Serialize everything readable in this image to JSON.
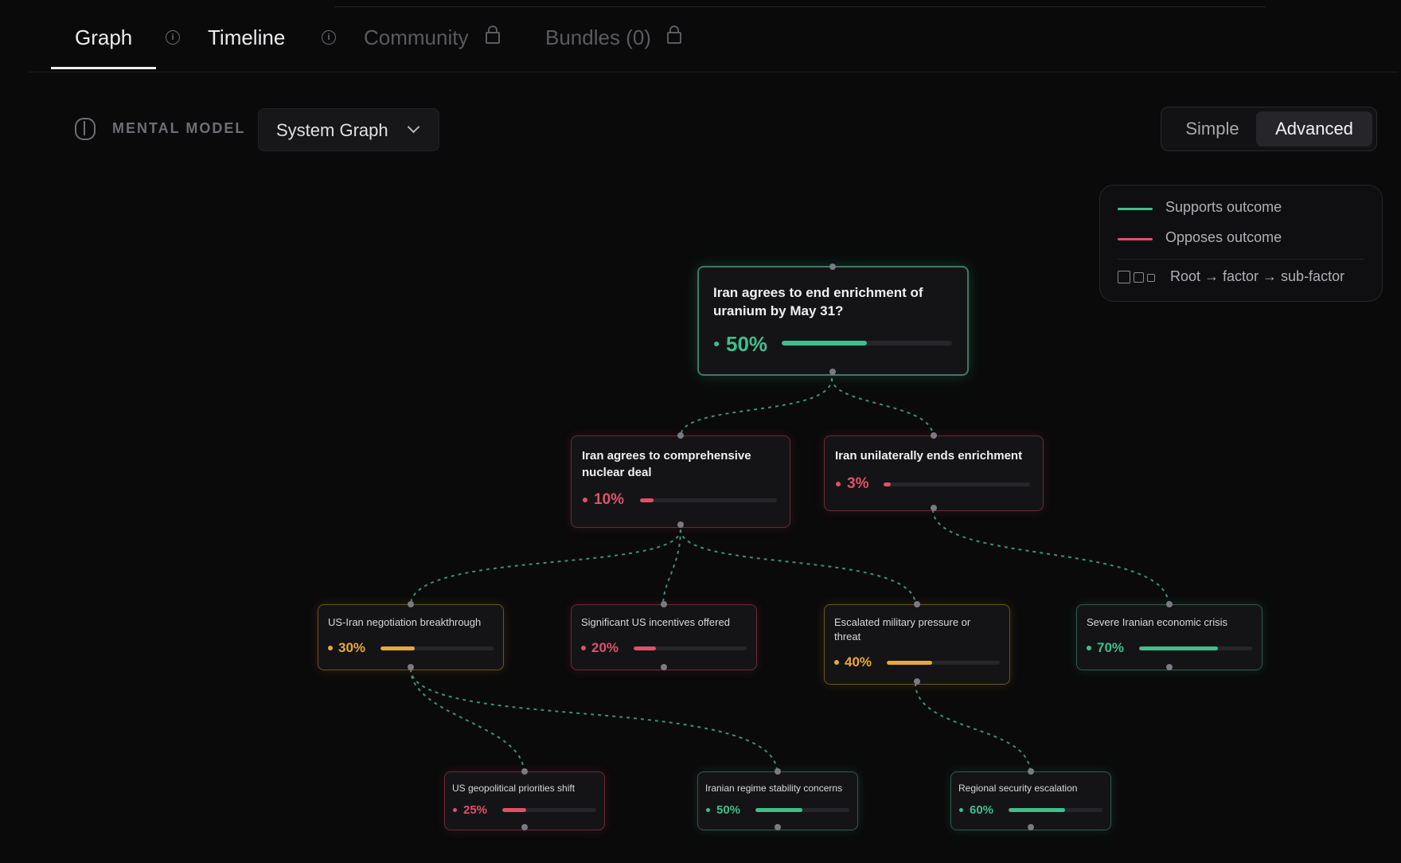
{
  "tabs": [
    {
      "label": "Graph",
      "active": true
    },
    {
      "label": "Timeline",
      "active": false
    },
    {
      "label": "Community",
      "locked": true
    },
    {
      "label": "Bundles (0)",
      "locked": true
    }
  ],
  "toolbar": {
    "mental_model_label": "MENTAL MODEL",
    "view_select": "System Graph",
    "mode_simple": "Simple",
    "mode_advanced": "Advanced",
    "active_mode": "Advanced"
  },
  "legend": {
    "supports": "Supports outcome",
    "opposes": "Opposes outcome",
    "hierarchy": "Root → factor → sub-factor"
  },
  "colors": {
    "supports": "#3fbf8c",
    "opposes": "#e0506a",
    "neutral": "#e8a83a"
  },
  "graph": {
    "root": {
      "title": "Iran agrees to end enrichment of uranium by May 31?",
      "pct": "50%",
      "value": 0.5,
      "tone": "supports"
    },
    "factors": [
      {
        "title": "Iran agrees to comprehensive nuclear deal",
        "pct": "10%",
        "value": 0.1,
        "tone": "opposes"
      },
      {
        "title": "Iran unilaterally ends enrichment",
        "pct": "3%",
        "value": 0.03,
        "tone": "opposes"
      }
    ],
    "subfactors": [
      {
        "title": "US-Iran negotiation breakthrough",
        "pct": "30%",
        "value": 0.3,
        "tone": "neutral"
      },
      {
        "title": "Significant US incentives offered",
        "pct": "20%",
        "value": 0.2,
        "tone": "opposes"
      },
      {
        "title": "Escalated military pressure or threat",
        "pct": "40%",
        "value": 0.4,
        "tone": "neutral"
      },
      {
        "title": "Severe Iranian economic crisis",
        "pct": "70%",
        "value": 0.7,
        "tone": "supports"
      }
    ],
    "leaves": [
      {
        "title": "US geopolitical priorities shift",
        "pct": "25%",
        "value": 0.25,
        "tone": "opposes"
      },
      {
        "title": "Iranian regime stability concerns",
        "pct": "50%",
        "value": 0.5,
        "tone": "supports"
      },
      {
        "title": "Regional security escalation",
        "pct": "60%",
        "value": 0.6,
        "tone": "supports"
      }
    ]
  }
}
